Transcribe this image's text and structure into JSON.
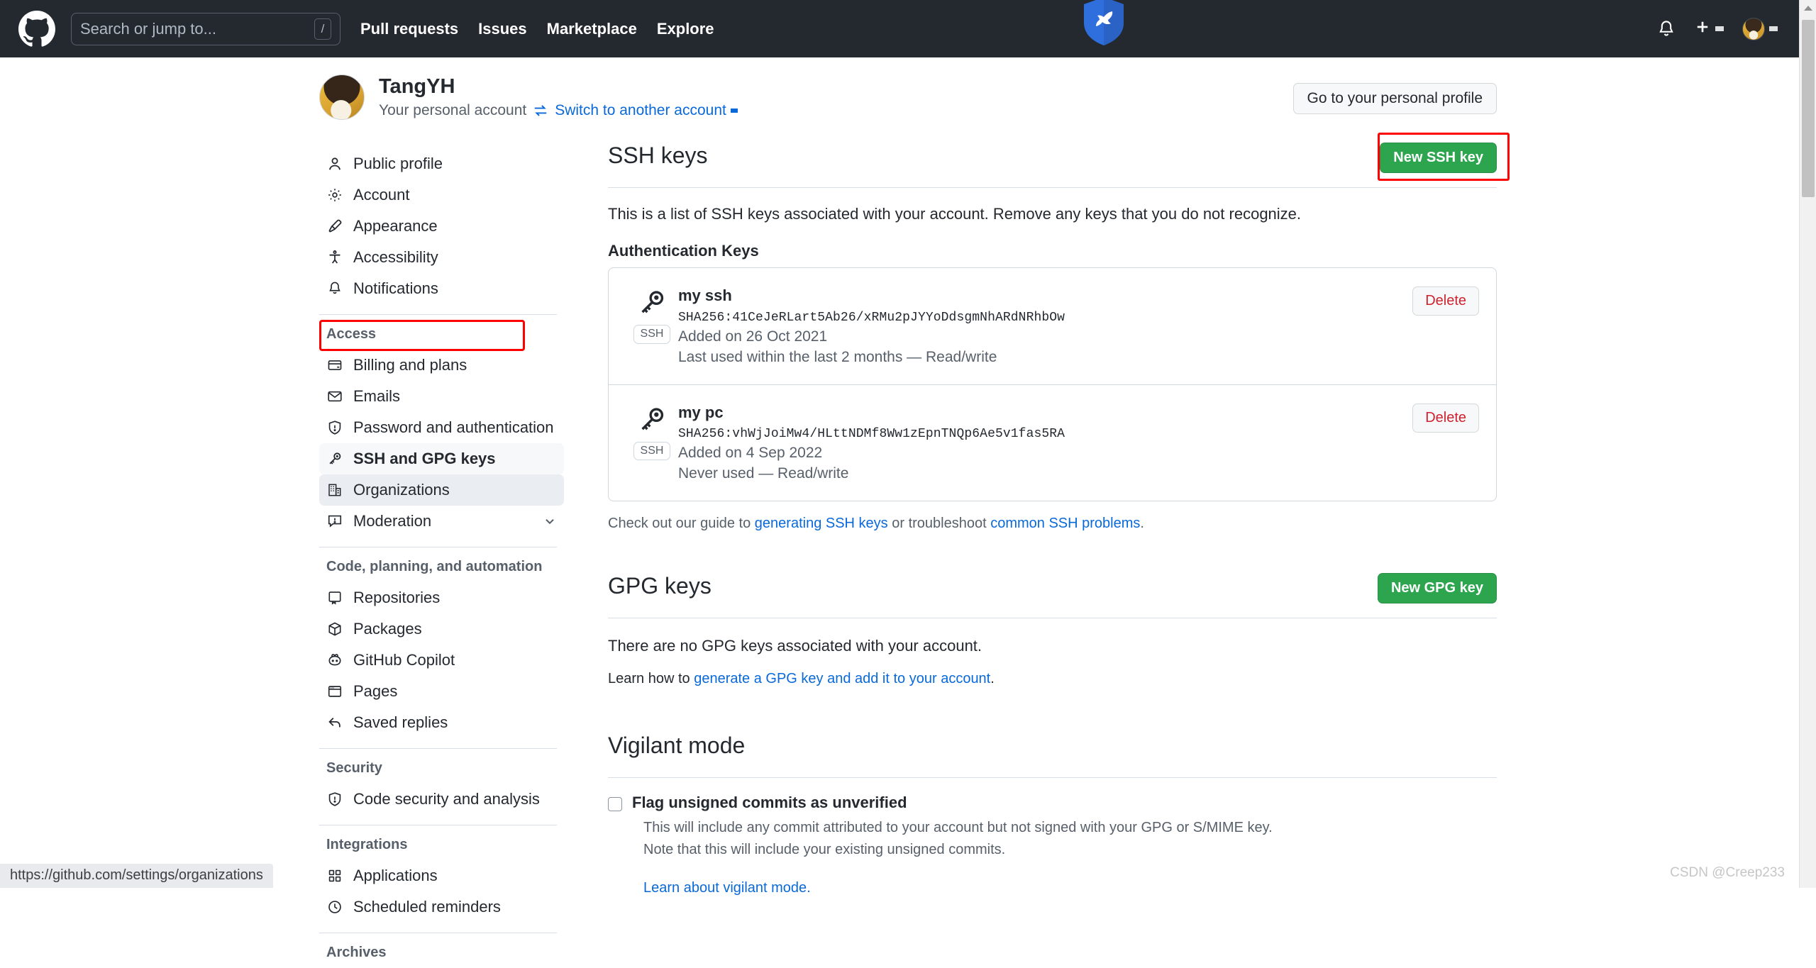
{
  "header": {
    "logo_icon": "github-mark-icon",
    "search": {
      "placeholder": "Search or jump to...",
      "shortcut": "/"
    },
    "nav": [
      {
        "label": "Pull requests"
      },
      {
        "label": "Issues"
      },
      {
        "label": "Marketplace"
      },
      {
        "label": "Explore"
      }
    ],
    "notifications_icon": "bell-icon",
    "create_new_icon": "plus-icon",
    "account_menu_icon": "avatar-caret-icon",
    "decoration_icon": "blue-bird-shield-icon",
    "bg_color": "#24292f"
  },
  "profile": {
    "avatar": "user-avatar",
    "name": "TangYH",
    "subtitle": "Your personal account",
    "switch_label": "Switch to another account",
    "switch_icon": "swap-icon",
    "personal_profile_button": "Go to your personal profile"
  },
  "sidebar": {
    "groups": [
      {
        "title": "",
        "items": [
          {
            "label": "Public profile",
            "icon": "person-icon",
            "state": "normal"
          },
          {
            "label": "Account",
            "icon": "gear-icon",
            "state": "normal"
          },
          {
            "label": "Appearance",
            "icon": "paintbrush-icon",
            "state": "normal"
          },
          {
            "label": "Accessibility",
            "icon": "accessibility-icon",
            "state": "normal"
          },
          {
            "label": "Notifications",
            "icon": "bell-icon",
            "state": "normal"
          }
        ]
      },
      {
        "title": "Access",
        "items": [
          {
            "label": "Billing and plans",
            "icon": "credit-card-icon",
            "state": "normal"
          },
          {
            "label": "Emails",
            "icon": "mail-icon",
            "state": "normal"
          },
          {
            "label": "Password and authentication",
            "icon": "shield-lock-icon",
            "state": "normal"
          },
          {
            "label": "SSH and GPG keys",
            "icon": "key-icon",
            "state": "selected"
          },
          {
            "label": "Organizations",
            "icon": "organization-icon",
            "state": "hovered"
          },
          {
            "label": "Moderation",
            "icon": "report-icon",
            "state": "normal",
            "expander": "chevron-down-icon"
          }
        ]
      },
      {
        "title": "Code, planning, and automation",
        "items": [
          {
            "label": "Repositories",
            "icon": "repo-icon",
            "state": "normal"
          },
          {
            "label": "Packages",
            "icon": "package-icon",
            "state": "normal"
          },
          {
            "label": "GitHub Copilot",
            "icon": "copilot-icon",
            "state": "normal"
          },
          {
            "label": "Pages",
            "icon": "browser-icon",
            "state": "normal"
          },
          {
            "label": "Saved replies",
            "icon": "reply-icon",
            "state": "normal"
          }
        ]
      },
      {
        "title": "Security",
        "items": [
          {
            "label": "Code security and analysis",
            "icon": "shield-check-icon",
            "state": "normal"
          }
        ]
      },
      {
        "title": "Integrations",
        "items": [
          {
            "label": "Applications",
            "icon": "apps-grid-icon",
            "state": "normal"
          },
          {
            "label": "Scheduled reminders",
            "icon": "clock-icon",
            "state": "normal"
          }
        ]
      },
      {
        "title": "Archives",
        "items": []
      }
    ]
  },
  "ssh_section": {
    "title": "SSH keys",
    "new_key_button": "New SSH key",
    "description": "This is a list of SSH keys associated with your account. Remove any keys that you do not recognize.",
    "subheading": "Authentication Keys",
    "keys": [
      {
        "name": "my ssh",
        "fingerprint": "SHA256:41CeJeRLart5Ab26/xRMu2pJYYoDdsgmNhARdNRhbOw",
        "added": "Added on 26 Oct 2021",
        "last_used": "Last used within the last 2 months — Read/write",
        "badge": "SSH",
        "key_icon": "key-icon",
        "delete_button": "Delete"
      },
      {
        "name": "my pc",
        "fingerprint": "SHA256:vhWjJoiMw4/HLttNDMf8Ww1zEpnTNQp6Ae5v1fas5RA",
        "added": "Added on 4 Sep 2022",
        "last_used": "Never used — Read/write",
        "badge": "SSH",
        "key_icon": "key-icon",
        "delete_button": "Delete"
      }
    ],
    "guide_prefix": "Check out our guide to ",
    "guide_link1": "generating SSH keys",
    "guide_middle": " or troubleshoot ",
    "guide_link2": "common SSH problems",
    "guide_suffix": "."
  },
  "gpg_section": {
    "title": "GPG keys",
    "new_key_button": "New GPG key",
    "empty_text": "There are no GPG keys associated with your account.",
    "learn_prefix": "Learn how to ",
    "learn_link": "generate a GPG key and add it to your account",
    "learn_suffix": "."
  },
  "vigilant_section": {
    "title": "Vigilant mode",
    "checkbox_label": "Flag unsigned commits as unverified",
    "checkbox_checked": false,
    "note_line1": "This will include any commit attributed to your account but not signed with your GPG or S/MIME key.",
    "note_line2": "Note that this will include your existing unsigned commits.",
    "learn_link": "Learn about vigilant mode."
  },
  "annotations": {
    "accent_color": "#ff0000",
    "boxes": [
      "new-ssh-key-button",
      "sidebar-ssh-and-gpg-keys"
    ]
  },
  "statusbar": {
    "url": "https://github.com/settings/organizations"
  },
  "watermark": {
    "text": "CSDN @Creep233"
  },
  "scrollbar": {
    "up_arrow_icon": "triangle-up-icon"
  },
  "colors": {
    "green": "#2da44e",
    "link": "#0969da",
    "danger": "#cf222e",
    "header_bg": "#24292f"
  }
}
